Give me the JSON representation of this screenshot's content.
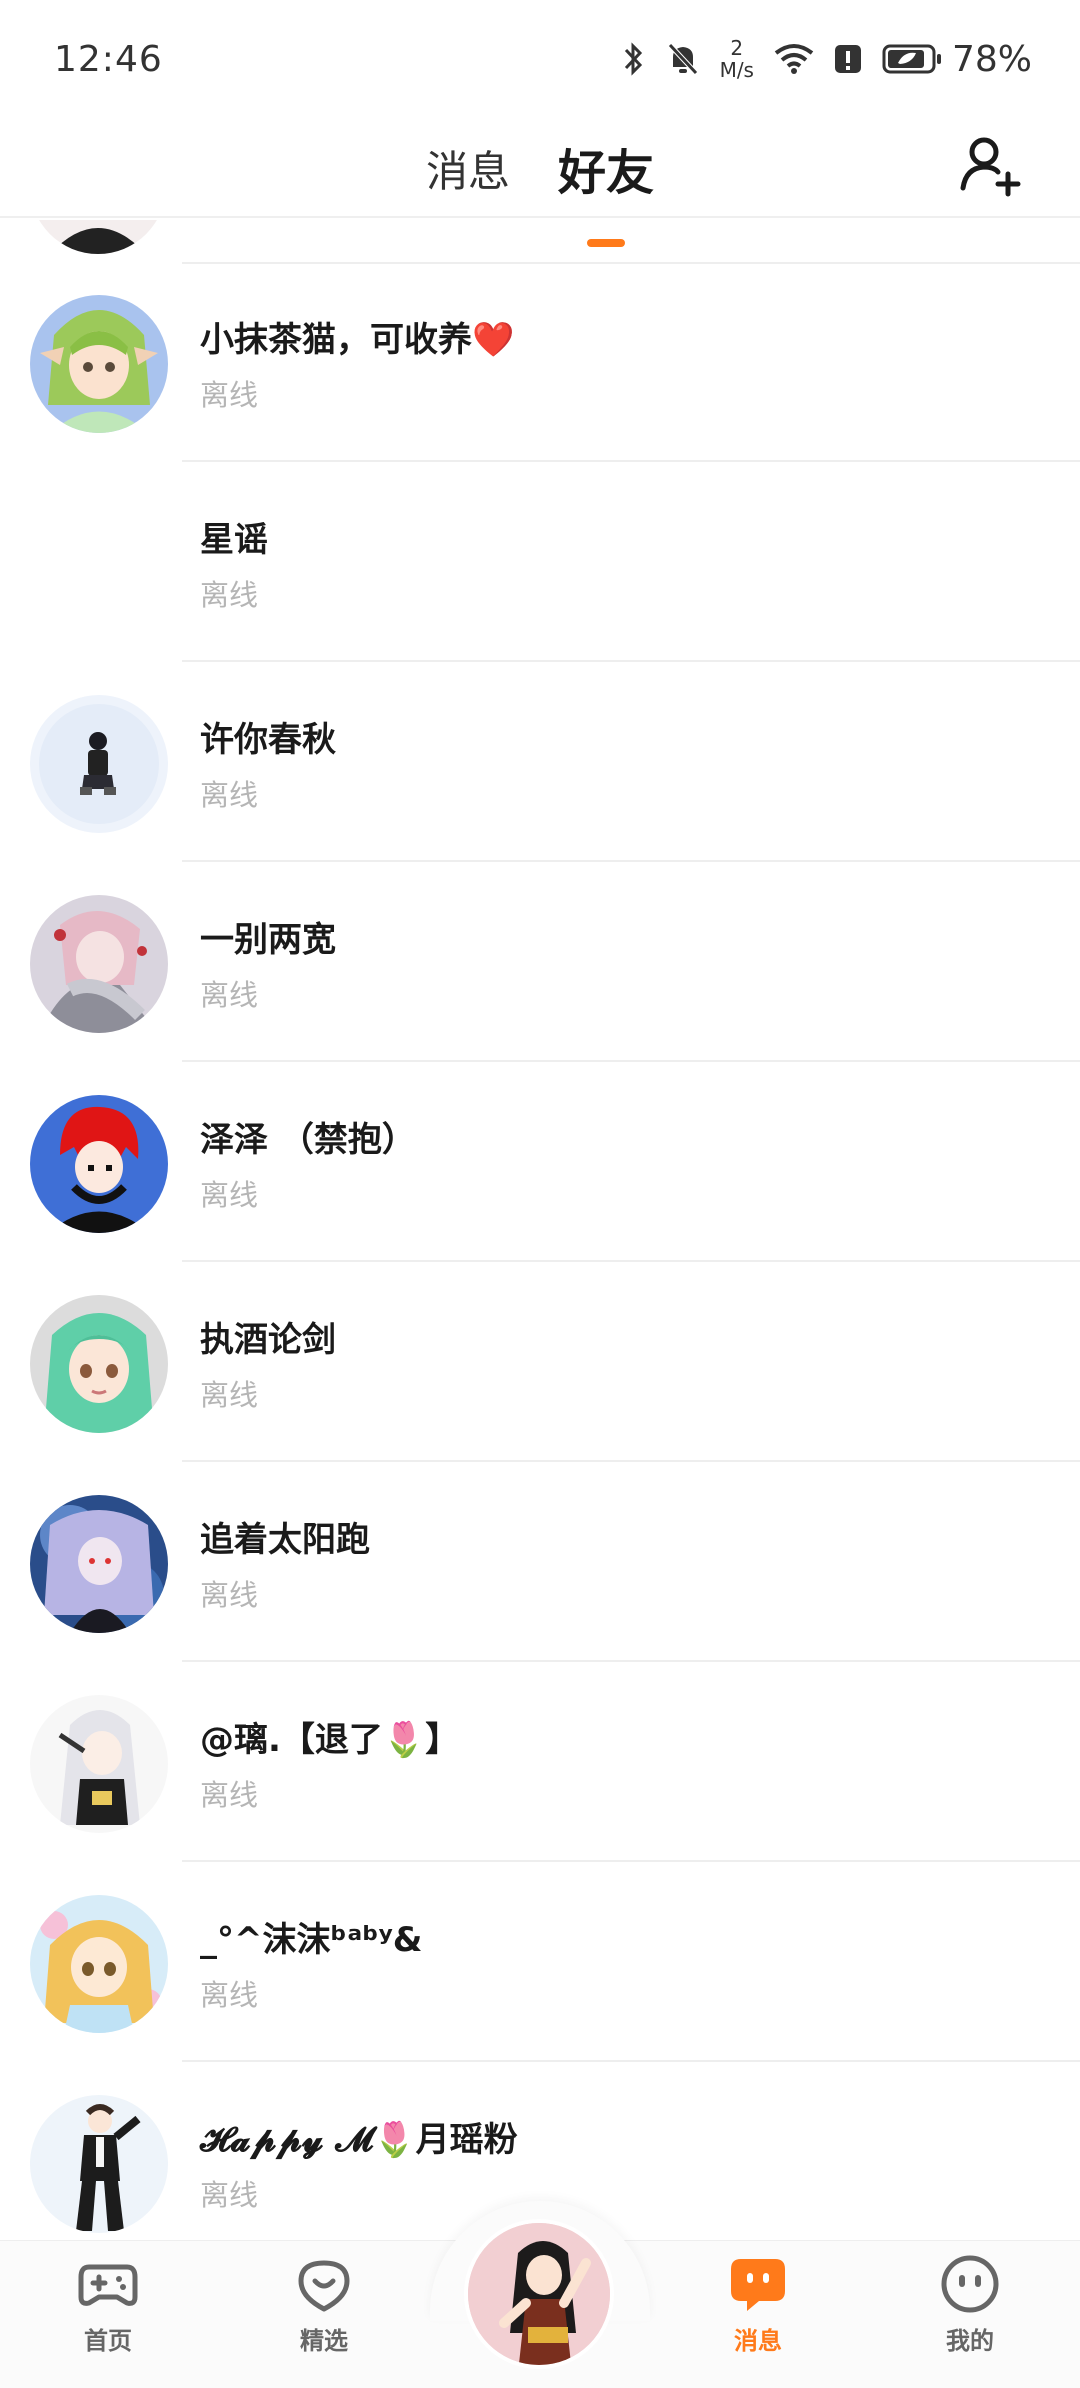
{
  "status_bar": {
    "time": "12:46",
    "net_speed_value": "2",
    "net_speed_unit": "M/s",
    "battery": "78%",
    "icons": [
      "bluetooth-icon",
      "mute-bell-icon",
      "wifi-icon",
      "alert-icon",
      "battery-icon"
    ]
  },
  "header": {
    "tabs": [
      {
        "label": "消息",
        "active": false
      },
      {
        "label": "好友",
        "active": true
      }
    ],
    "accent": "#ff7a1a",
    "add_friend_icon": "add-user-icon"
  },
  "friends": [
    {
      "name": "小抹茶猫，可收养❤️",
      "status": "离线",
      "avatar": "avatar-green-hair"
    },
    {
      "name": "星谣",
      "status": "离线",
      "avatar": "none"
    },
    {
      "name": "许你春秋",
      "status": "离线",
      "avatar": "avatar-small-figure"
    },
    {
      "name": "一别两宽",
      "status": "离线",
      "avatar": "avatar-pink-hair"
    },
    {
      "name": "泽泽 （禁抱）",
      "status": "离线",
      "avatar": "avatar-red-hair"
    },
    {
      "name": "执酒论剑",
      "status": "离线",
      "avatar": "avatar-teal-hair"
    },
    {
      "name": "追着太阳跑",
      "status": "离线",
      "avatar": "avatar-lilac-hair"
    },
    {
      "name": "@璃.【退了🌷】",
      "status": "离线",
      "avatar": "avatar-white-hair"
    },
    {
      "name": "_°^沫沫ᵇᵃᵇʸ&",
      "status": "离线",
      "avatar": "avatar-blonde-hair"
    },
    {
      "name": "𝓗𝓪𝓹𝓹𝔂 𝓜🌷月瑶粉",
      "status": "离线",
      "avatar": "avatar-suit-figure"
    }
  ],
  "bottom_nav": {
    "items": [
      {
        "label": "首页",
        "icon": "gamepad-icon",
        "active": false
      },
      {
        "label": "精选",
        "icon": "heart-bubble-icon",
        "active": false
      },
      {
        "label": "消息",
        "icon": "chat-bubble-icon",
        "active": true
      },
      {
        "label": "我的",
        "icon": "smiley-face-icon",
        "active": false
      }
    ],
    "center_avatar": "user-avatar"
  },
  "colors": {
    "accent": "#ff7a1a",
    "status_gray": "#b5b5b5",
    "separator": "#eeeeee"
  }
}
